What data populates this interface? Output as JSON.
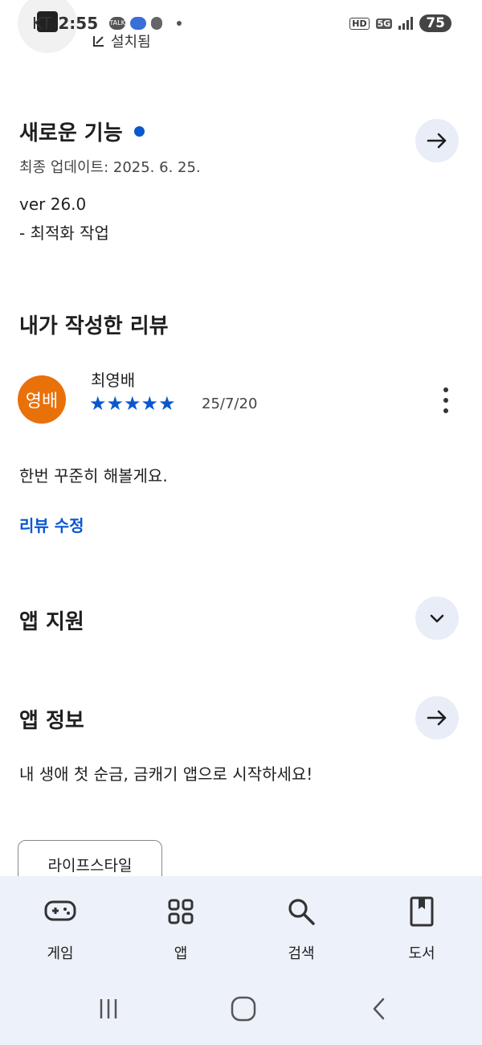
{
  "status_bar": {
    "carrier": "KT",
    "time": "2:55",
    "hd_badge": "HD",
    "network": "5G",
    "battery": "75"
  },
  "header": {
    "installed_label": "설치됨"
  },
  "whats_new": {
    "title": "새로운 기능",
    "last_updated": "최종 업데이트: 2025. 6. 25.",
    "version": "ver 26.0",
    "note": "- 최적화 작업"
  },
  "my_review": {
    "title": "내가 작성한 리뷰",
    "avatar_text": "영배",
    "reviewer": "최영배",
    "rating": 5,
    "stars": "★★★★★",
    "date": "25/7/20",
    "text": "한번 꾸준히 해볼게요.",
    "edit_label": "리뷰 수정"
  },
  "app_support": {
    "title": "앱 지원"
  },
  "app_info": {
    "title": "앱 정보",
    "description": "내 생애 첫 순금, 금캐기 앱으로 시작하세요!",
    "chip": "라이프스타일"
  },
  "bottom_nav": {
    "items": [
      {
        "label": "게임",
        "icon": "gamepad-icon"
      },
      {
        "label": "앱",
        "icon": "apps-grid-icon"
      },
      {
        "label": "검색",
        "icon": "search-icon"
      },
      {
        "label": "도서",
        "icon": "book-icon"
      }
    ]
  },
  "colors": {
    "accent": "#0b57d0",
    "avatar": "#e8710a",
    "nav_bg": "#edf1f9",
    "button_bg": "#e8edf7"
  }
}
